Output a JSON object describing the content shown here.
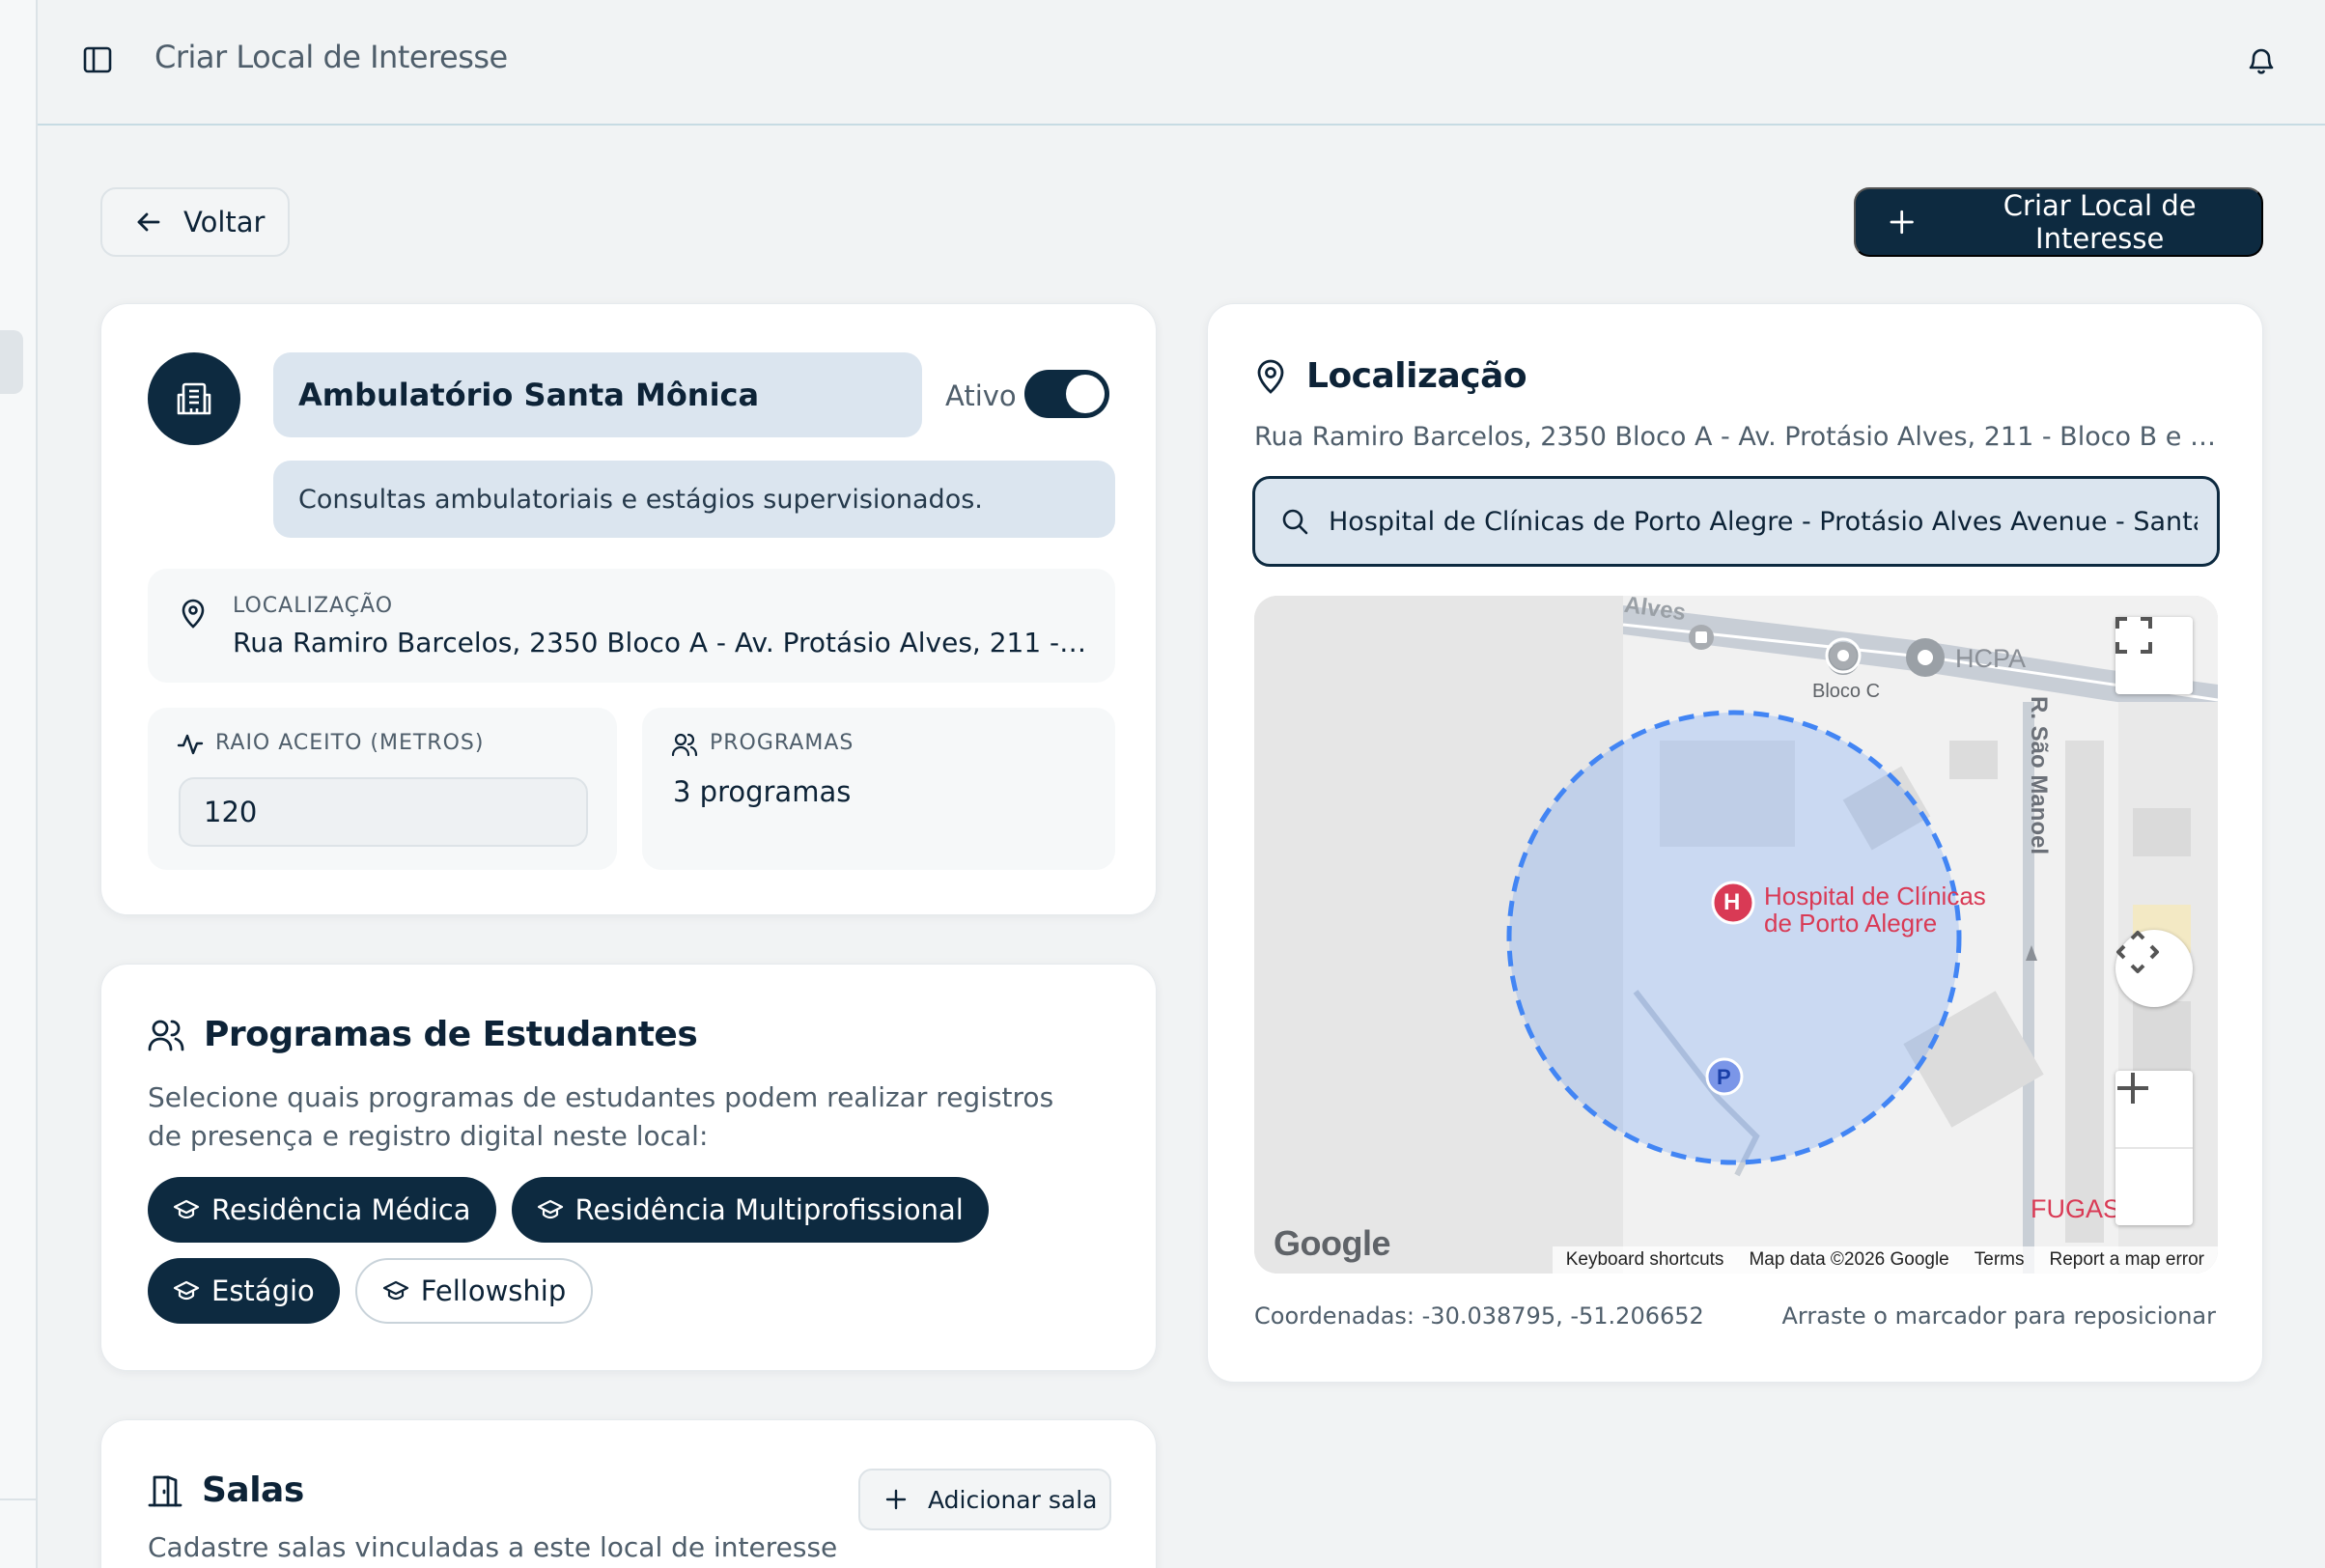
{
  "topbar": {
    "title": "Criar Local de Interesse"
  },
  "actions": {
    "back_label": "Voltar",
    "create_label": "Criar Local de Interesse"
  },
  "place": {
    "name": "Ambulatório Santa Mônica",
    "active_label": "Ativo",
    "active": true,
    "description": "Consultas ambulatoriais e estágios supervisionados.",
    "location_label": "LOCALIZAÇÃO",
    "location_value": "Rua Ramiro Barcelos, 2350 Bloco A - Av. Protásio Alves, 211 - Blo...",
    "radius_label": "RAIO ACEITO (METROS)",
    "radius_value": "120",
    "programs_label": "PROGRAMAS",
    "programs_value": "3 programas"
  },
  "programs": {
    "title": "Programas de Estudantes",
    "subtitle": "Selecione quais programas de estudantes podem realizar registros de presença e registro digital neste local:",
    "chips": [
      {
        "label": "Residência Médica",
        "selected": true
      },
      {
        "label": "Residência Multiprofissional",
        "selected": true
      },
      {
        "label": "Estágio",
        "selected": true
      },
      {
        "label": "Fellowship",
        "selected": false
      }
    ]
  },
  "rooms": {
    "title": "Salas",
    "add_label": "Adicionar sala",
    "subtitle": "Cadastre salas vinculadas a este local de interesse"
  },
  "map": {
    "title": "Localização",
    "address": "Rua Ramiro Barcelos, 2350 Bloco A - Av. Protásio Alves, 211 - Bloco B e C -...",
    "search_value": "Hospital de Clínicas de Porto Alegre - Protásio Alves Avenue - Santa Cecília",
    "labels": {
      "street_top": "Alves",
      "hcpa": "HCPA",
      "bloco_c": "Bloco C",
      "street_right": "R. São Manoel",
      "hospital_line1": "Hospital de Clínicas",
      "hospital_line2": "de Porto Alegre",
      "fugas": "FUGAS",
      "google": "Google"
    },
    "footer": {
      "shortcuts": "Keyboard shortcuts",
      "data": "Map data ©2026 Google",
      "terms": "Terms",
      "report": "Report a map error"
    },
    "coordinates": "Coordenadas: -30.038795, -51.206652",
    "drag_hint": "Arraste o marcador para reposicionar"
  },
  "colors": {
    "primary": "#0d2a40",
    "field_bg": "#dbe5ef",
    "radius_circle": "#4285f4",
    "hospital_pin": "#d93a55"
  }
}
